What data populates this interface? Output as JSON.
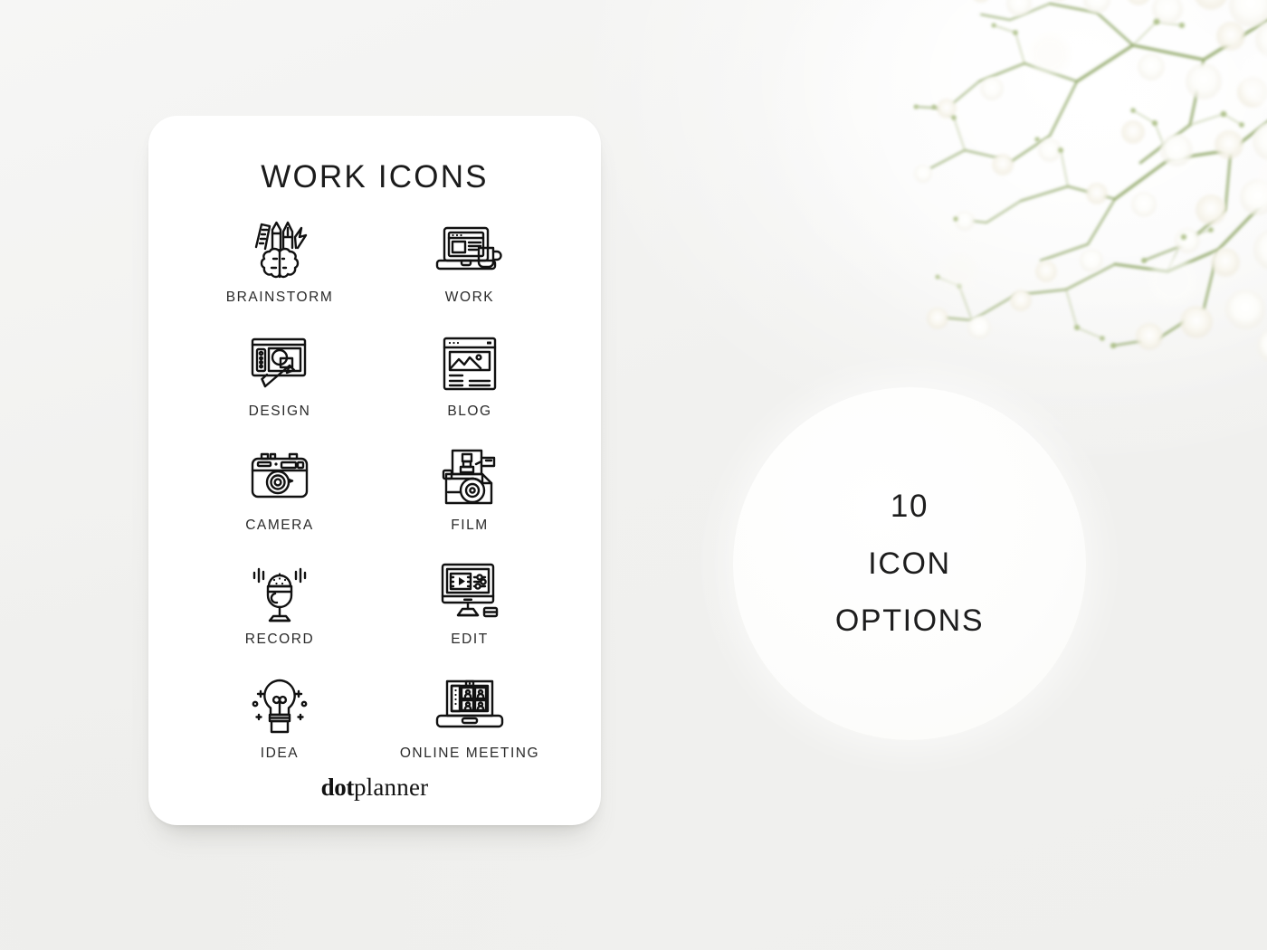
{
  "background": {
    "base_color": "#f2f2f0",
    "photo_subject": "babys-breath-flowers",
    "flower_petal_color": "#ffffff",
    "flower_stem_color": "#8fa86a"
  },
  "card": {
    "title": "WORK ICONS",
    "background_color": "#ffffff",
    "brand": {
      "bold_part": "dot",
      "regular_part": "planner"
    },
    "icons": [
      {
        "label": "BRAINSTORM",
        "icon_name": "brain-with-tools-icon"
      },
      {
        "label": "WORK",
        "icon_name": "laptop-with-coffee-icon"
      },
      {
        "label": "DESIGN",
        "icon_name": "graphics-tablet-stylus-icon"
      },
      {
        "label": "BLOG",
        "icon_name": "browser-article-icon"
      },
      {
        "label": "CAMERA",
        "icon_name": "photo-camera-icon"
      },
      {
        "label": "FILM",
        "icon_name": "movie-camera-icon"
      },
      {
        "label": "RECORD",
        "icon_name": "microphone-icon"
      },
      {
        "label": "EDIT",
        "icon_name": "monitor-video-editing-icon"
      },
      {
        "label": "IDEA",
        "icon_name": "lightbulb-icon"
      },
      {
        "label": "ONLINE MEETING",
        "icon_name": "laptop-video-call-icon"
      }
    ]
  },
  "callout": {
    "count": "10",
    "line2": "ICON",
    "line3": "OPTIONS",
    "circle_color": "#ffffff"
  }
}
